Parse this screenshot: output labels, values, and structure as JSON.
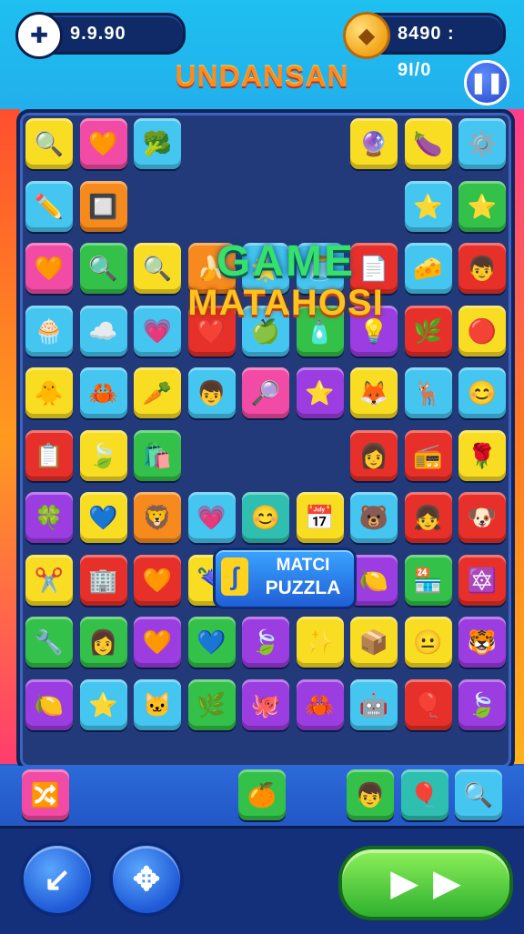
{
  "hud": {
    "coins_value": "9.9.90",
    "score_value": "8490 : 9I/0",
    "puzzle_icon": "puzzle-piece-icon",
    "coin_icon": "gold-coin-icon"
  },
  "title": "UNDANSAN",
  "pause_icon": "pause-icon",
  "banner": {
    "line1": "GAME",
    "line2": "MATAHOSI"
  },
  "match_badge": {
    "line1": "MATCI",
    "line2": "PUZZLA"
  },
  "colors": {
    "yellow": "#f9dd22",
    "pink": "#f24ba6",
    "cyan": "#45c6f0",
    "orange": "#f78a1d",
    "green": "#33c14a",
    "purple": "#9b3de0",
    "red": "#e8302a",
    "teal": "#2fbfb0"
  },
  "grid": {
    "cols": 9,
    "rows": 10,
    "tiles": [
      [
        [
          "yellow",
          "🔍"
        ],
        [
          "pink",
          "🧡"
        ],
        [
          "cyan",
          "🥦"
        ],
        null,
        null,
        null,
        [
          "yellow",
          "🔮"
        ],
        [
          "yellow",
          "🍆"
        ],
        [
          "cyan",
          "⚙️"
        ]
      ],
      [
        [
          "cyan",
          "✏️"
        ],
        [
          "orange",
          "🔲"
        ],
        null,
        null,
        null,
        null,
        null,
        [
          "cyan",
          "⭐"
        ],
        [
          "green",
          "⭐"
        ]
      ],
      [
        [
          "pink",
          "🧡"
        ],
        [
          "green",
          "🔍"
        ],
        [
          "yellow",
          "🔍"
        ],
        [
          "orange",
          "🍌"
        ],
        [
          "cyan",
          "🌟"
        ],
        [
          "cyan",
          "🫙"
        ],
        [
          "red",
          "📄"
        ],
        [
          "cyan",
          "🧀"
        ],
        [
          "red",
          "👦"
        ]
      ],
      [
        [
          "cyan",
          "🧁"
        ],
        [
          "cyan",
          "☁️"
        ],
        [
          "cyan",
          "💗"
        ],
        [
          "red",
          "❤️"
        ],
        [
          "cyan",
          "🍏"
        ],
        [
          "green",
          "🧴"
        ],
        [
          "purple",
          "💡"
        ],
        [
          "red",
          "🌿"
        ],
        [
          "yellow",
          "🔴"
        ]
      ],
      [
        [
          "yellow",
          "🐥"
        ],
        [
          "cyan",
          "🦀"
        ],
        [
          "yellow",
          "🥕"
        ],
        [
          "cyan",
          "👦"
        ],
        [
          "pink",
          "🔎"
        ],
        [
          "purple",
          "⭐"
        ],
        [
          "yellow",
          "🦊"
        ],
        [
          "cyan",
          "🦌"
        ],
        [
          "cyan",
          "😊"
        ]
      ],
      [
        [
          "red",
          "📋"
        ],
        [
          "yellow",
          "🍃"
        ],
        [
          "green",
          "🛍️"
        ],
        null,
        null,
        null,
        [
          "red",
          "👩"
        ],
        [
          "red",
          "📻"
        ],
        [
          "yellow",
          "🌹"
        ]
      ],
      [
        [
          "purple",
          "🍀"
        ],
        [
          "yellow",
          "💙"
        ],
        [
          "orange",
          "🦁"
        ],
        [
          "cyan",
          "💗"
        ],
        [
          "teal",
          "😊"
        ],
        [
          "yellow",
          "📅"
        ],
        [
          "cyan",
          "🐻"
        ],
        [
          "red",
          "👧"
        ],
        [
          "red",
          "🐶"
        ]
      ],
      [
        [
          "yellow",
          "✂️"
        ],
        [
          "red",
          "🏢"
        ],
        [
          "red",
          "🧡"
        ],
        [
          "yellow",
          "🌂"
        ],
        [
          "purple",
          "🍃"
        ],
        [
          "yellow",
          "🥦"
        ],
        [
          "purple",
          "🍋"
        ],
        [
          "green",
          "🏪"
        ],
        [
          "red",
          "🔯"
        ]
      ],
      [
        [
          "green",
          "🔧"
        ],
        [
          "green",
          "👩"
        ],
        [
          "purple",
          "🧡"
        ],
        [
          "green",
          "💙"
        ],
        [
          "purple",
          "🍃"
        ],
        [
          "yellow",
          "✨"
        ],
        [
          "yellow",
          "📦"
        ],
        [
          "yellow",
          "😐"
        ],
        [
          "purple",
          "🐯"
        ]
      ],
      [
        [
          "purple",
          "🍋"
        ],
        [
          "cyan",
          "⭐"
        ],
        [
          "cyan",
          "🐱"
        ],
        [
          "green",
          "🌿"
        ],
        [
          "purple",
          "🐙"
        ],
        [
          "purple",
          "🦀"
        ],
        [
          "cyan",
          "🤖"
        ],
        [
          "red",
          "🎈"
        ],
        [
          "purple",
          "🍃"
        ]
      ]
    ]
  },
  "tray": [
    {
      "col": 0,
      "color": "pink",
      "icon": "🔀"
    },
    {
      "col": 4,
      "color": "green",
      "icon": "🍊"
    },
    {
      "col": 6,
      "color": "green",
      "icon": "👦"
    },
    {
      "col": 7,
      "color": "teal",
      "icon": "🎈"
    },
    {
      "col": 8,
      "color": "cyan",
      "icon": "🔍"
    }
  ],
  "controls": {
    "back_icon": "undo-arrow-icon",
    "back_glyph": "↙",
    "shuffle_icon": "shuffle-puzzle-icon",
    "shuffle_glyph": "✥",
    "play_icon": "play-icon",
    "play_glyphs": [
      "▶",
      "▶"
    ]
  }
}
